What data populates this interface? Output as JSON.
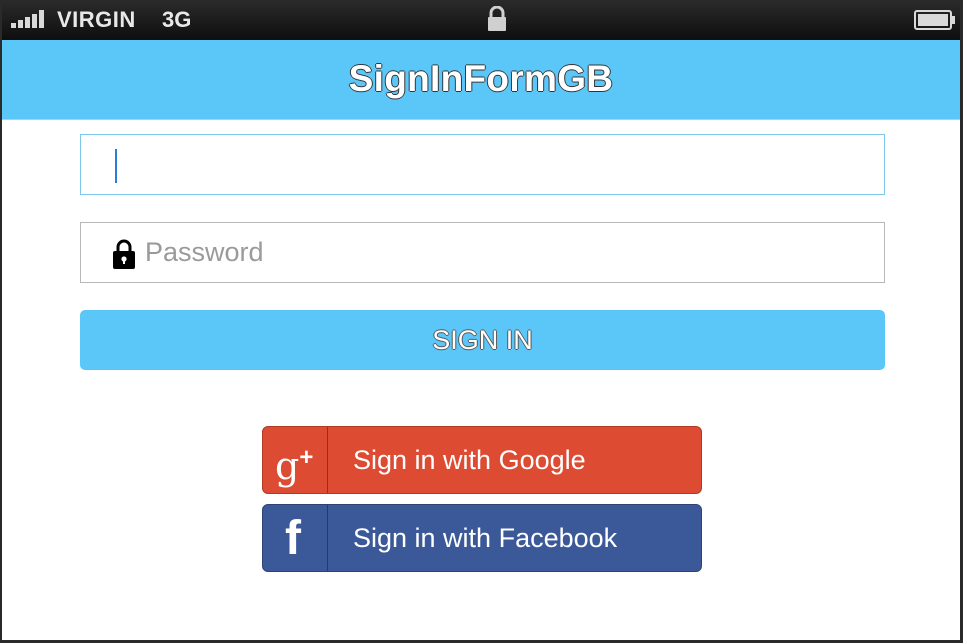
{
  "status_bar": {
    "carrier": "VIRGIN",
    "network": "3G",
    "icons": [
      "signal-icon",
      "lock-icon",
      "battery-icon"
    ]
  },
  "nav": {
    "title": "SignInFormGB"
  },
  "form": {
    "username_value": "",
    "password_placeholder": "Password",
    "signin_label": "SIGN IN"
  },
  "social": {
    "google_label": "Sign in with Google",
    "google_icon_text": "g",
    "google_icon_plus": "+",
    "facebook_label": "Sign in with Facebook",
    "facebook_icon_text": "f"
  },
  "colors": {
    "accent": "#5bc7f9",
    "google": "#dd4b32",
    "facebook": "#3b5998"
  }
}
